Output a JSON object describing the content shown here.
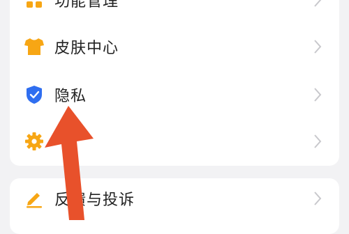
{
  "settings": {
    "items": [
      {
        "label": "功能管理",
        "icon": "grid-icon"
      },
      {
        "label": "皮肤中心",
        "icon": "tshirt-icon"
      },
      {
        "label": "隐私",
        "icon": "shield-check-icon"
      },
      {
        "label": "",
        "icon": "gear-icon"
      }
    ],
    "feedback": {
      "label": "反馈与投诉",
      "icon": "pencil-icon"
    }
  },
  "colors": {
    "accent_orange": "#f7a614",
    "shield_blue": "#2f6ef0",
    "arrow_red": "#e8512b",
    "chevron": "#c8c8cc"
  }
}
